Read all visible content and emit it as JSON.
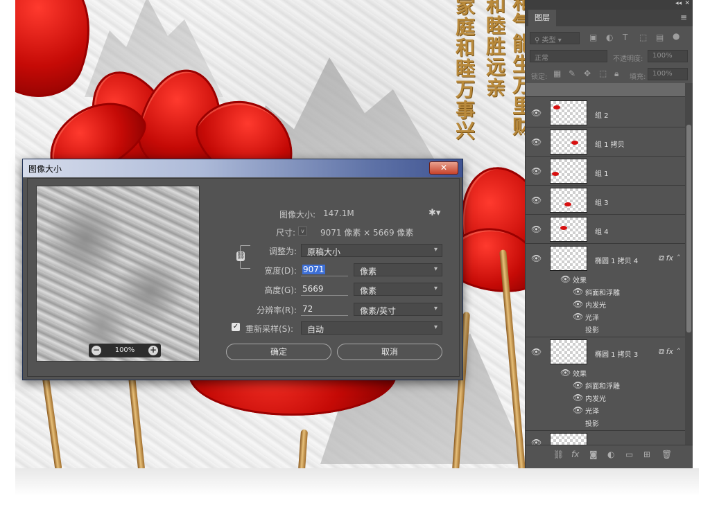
{
  "canvas": {
    "calligraphy_col1": "家庭和睦万事兴",
    "calligraphy_col2": "和睦胜远亲",
    "calligraphy_col3": "和气能生万里财"
  },
  "dialog": {
    "title": "图像大小",
    "close_label": "✕",
    "image_size_label": "图像大小:",
    "image_size_value": "147.1M",
    "dimensions_label": "尺寸:",
    "dimensions_value": "9071 像素 × 5669 像素",
    "fit_to_label": "调整为:",
    "fit_to_value": "原稿大小",
    "width_label": "宽度(D):",
    "width_value": "9071",
    "width_unit": "像素",
    "height_label": "高度(G):",
    "height_value": "5669",
    "height_unit": "像素",
    "resolution_label": "分辨率(R):",
    "resolution_value": "72",
    "resolution_unit": "像素/英寸",
    "resample_label": "重新采样(S):",
    "resample_checked": true,
    "resample_value": "自动",
    "preview_zoom": "100%",
    "ok_label": "确定",
    "cancel_label": "取消"
  },
  "layers_panel": {
    "tab": "图层",
    "kind_filter": "类型",
    "blend_mode": "正常",
    "opacity_label": "不透明度:",
    "opacity_value": "100%",
    "lock_label": "锁定:",
    "fill_label": "填充:",
    "fill_value": "100%",
    "layers": [
      {
        "name": "组 2"
      },
      {
        "name": "组 1 拷贝"
      },
      {
        "name": "组 1"
      },
      {
        "name": "组 3"
      },
      {
        "name": "组 4"
      },
      {
        "name": "椭圆 1 拷贝 4"
      },
      {
        "name": "椭圆 1 拷贝 3"
      }
    ],
    "effects_label": "效果",
    "effect_bevel": "斜面和浮雕",
    "effect_inner_glow": "内发光",
    "effect_satin": "光泽",
    "effect_drop_shadow": "投影"
  },
  "colors": {
    "accent_red": "#d81010",
    "panel_bg": "#535353",
    "selection_blue": "#3d6fd6"
  }
}
